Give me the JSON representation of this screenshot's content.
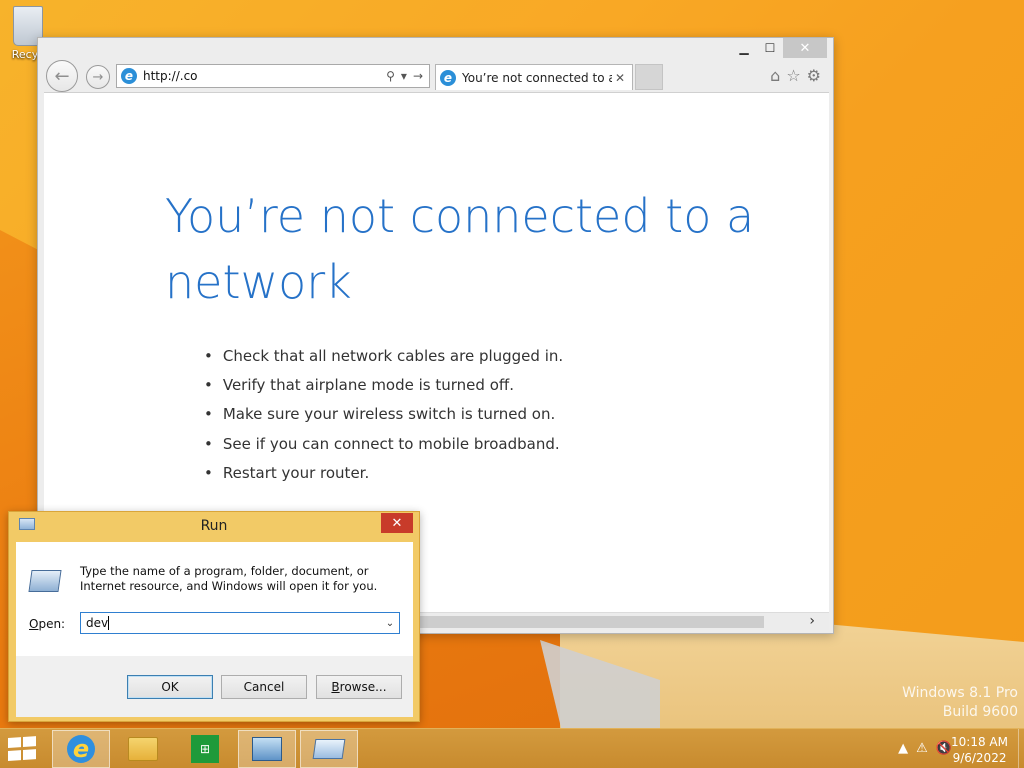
{
  "desktop": {
    "recycle_bin_label": "Recyc",
    "watermark": [
      "Windows 8.1 Pro",
      "Build 9600"
    ]
  },
  "ie": {
    "address": "http://.co",
    "tab_title": "You’re not connected to a ...",
    "error_title": "You’re not connected to a network",
    "bullets": [
      "Check that all network cables are plugged in.",
      "Verify that airplane mode is turned off.",
      "Make sure your wireless switch is turned on.",
      "See if you can connect to mobile broadband.",
      "Restart your router."
    ],
    "icons": [
      "back-icon",
      "forward-icon",
      "search-icon",
      "refresh-icon",
      "home-icon",
      "favorites-icon",
      "settings-icon"
    ]
  },
  "run": {
    "title": "Run",
    "description": "Type the name of a program, folder, document, or Internet resource, and Windows will open it for you.",
    "open_label_underlined": "O",
    "open_label_rest": "pen:",
    "open_value": "dev",
    "ok_label": "OK",
    "cancel_label": "Cancel",
    "browse_label_underlined": "B",
    "browse_label_rest": "rowse..."
  },
  "taskbar": {
    "items": [
      "internet-explorer",
      "file-explorer",
      "store",
      "remote-desktop",
      "run"
    ],
    "time": "10:18 AM",
    "date": "9/6/2022"
  },
  "colors": {
    "accent_blue": "#2672c8",
    "desktop_orange": "#f7b32b",
    "run_frame": "#f2ca66",
    "close_red": "#c83b2a"
  }
}
